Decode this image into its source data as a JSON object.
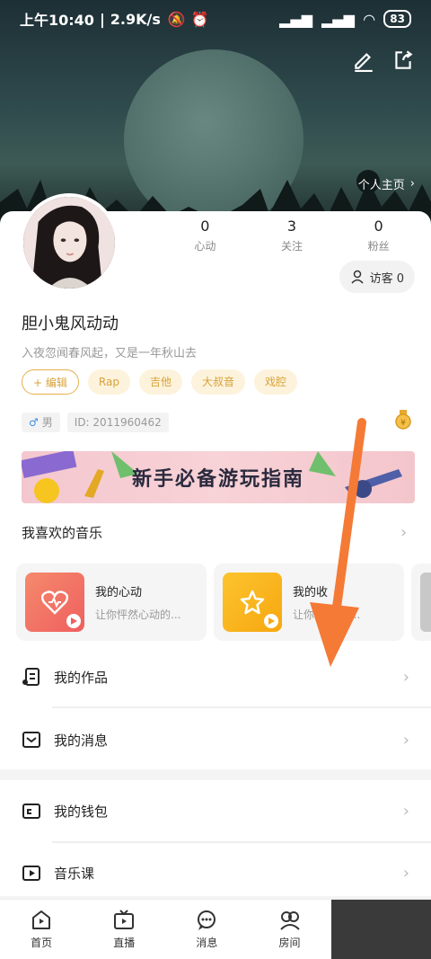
{
  "status_bar": {
    "time": "上午10:40",
    "speed": "2.9K/s",
    "battery": "83"
  },
  "header": {
    "homepage_link": "个人主页"
  },
  "profile": {
    "stats": [
      {
        "num": "0",
        "label": "心动"
      },
      {
        "num": "3",
        "label": "关注"
      },
      {
        "num": "0",
        "label": "粉丝"
      }
    ],
    "visitor": "访客 0",
    "username": "胆小鬼风动动",
    "bio": "入夜忽闻春风起，又是一年秋山去",
    "tags": {
      "edit": "编辑",
      "t1": "Rap",
      "t2": "吉他",
      "t3": "大叔音",
      "t4": "戏腔"
    },
    "gender": "男",
    "id": "ID: 2011960462"
  },
  "banner": {
    "text": "新手必备游玩指南"
  },
  "music": {
    "section_title": "我喜欢的音乐",
    "cards": [
      {
        "title": "我的心动",
        "subtitle": "让你怦然心动的..."
      },
      {
        "title": "我的收",
        "subtitle": "让你独   味的..."
      }
    ]
  },
  "menu": {
    "works": "我的作品",
    "messages": "我的消息",
    "wallet": "我的钱包",
    "course": "音乐课"
  },
  "nav": {
    "home": "首页",
    "live": "直播",
    "messages": "消息",
    "rooms": "房间"
  },
  "colors": {
    "accent": "#e6b04c",
    "heart_card": "#f2706a",
    "star_card": "#fbb71c",
    "arrow": "#f47a36"
  }
}
